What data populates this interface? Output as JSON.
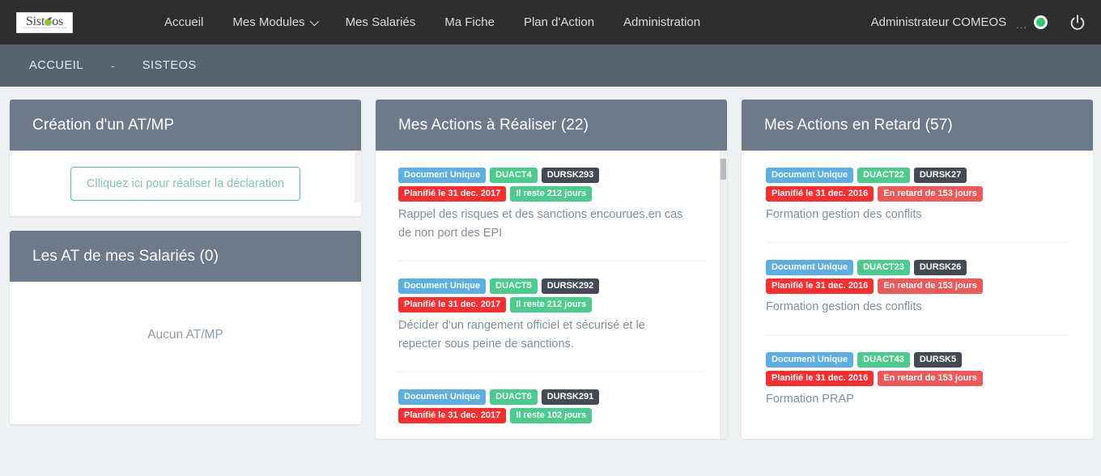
{
  "navbar": {
    "brand": {
      "text_before": "Sist",
      "apple_letter": "e",
      "text_after": "os",
      "tagline": "SOLUTION INFORMATIQUE SANTE & SECURITE AU TRAVAIL"
    },
    "links": [
      {
        "label": "Accueil",
        "has_caret": false
      },
      {
        "label": "Mes Modules",
        "has_caret": true
      },
      {
        "label": "Mes Salariés",
        "has_caret": false
      },
      {
        "label": "Ma Fiche",
        "has_caret": false
      },
      {
        "label": "Plan d'Action",
        "has_caret": false
      },
      {
        "label": "Administration",
        "has_caret": false
      }
    ],
    "user_name": "Administrateur COMEOS",
    "dots": "...",
    "status_color": "#2ecc71",
    "power_icon": "power-icon",
    "background_color": "#2e2e2e"
  },
  "breadcrumb": {
    "items": [
      "ACCUEIL",
      "SISTEOS"
    ],
    "separator": "-",
    "background_color": "#566470"
  },
  "colors": {
    "card_header": "#6c7a89",
    "page_background": "#eef2f3",
    "badge_blue": "#5bafe3",
    "badge_green": "#4bcc8e",
    "badge_dark": "#434a54",
    "badge_red": "#f92f2f",
    "badge_salmon": "#ef5858",
    "accent_green": "#4bcc94"
  },
  "cards": {
    "declaration": {
      "title": "Création d'un AT/MP",
      "button_label": "Clliquez ici pour réaliser la déclaration"
    },
    "employee_at": {
      "title": "Les AT de mes Salariés (0)",
      "empty_text": "Aucun AT/MP"
    },
    "actions_todo": {
      "title": "Mes Actions à Réaliser (22)",
      "items": [
        {
          "badges": [
            {
              "label": "Document Unique",
              "color": "#5bafe3"
            },
            {
              "label": "DUACT4",
              "color": "#4bcc8e"
            },
            {
              "label": "DURSK293",
              "color": "#434a54"
            }
          ],
          "badges2": [
            {
              "label": "Planifié le 31 dec. 2017",
              "color": "#f92f2f"
            },
            {
              "label": "Il reste 212 jours",
              "color": "#4bcc8e"
            }
          ],
          "description": "Rappel des risques et des sanctions encourues.en cas de non port des EPI"
        },
        {
          "badges": [
            {
              "label": "Document Unique",
              "color": "#5bafe3"
            },
            {
              "label": "DUACT5",
              "color": "#4bcc8e"
            },
            {
              "label": "DURSK292",
              "color": "#434a54"
            }
          ],
          "badges2": [
            {
              "label": "Planifié le 31 dec. 2017",
              "color": "#f92f2f"
            },
            {
              "label": "Il reste 212 jours",
              "color": "#4bcc8e"
            }
          ],
          "description": "Décider d'un rangement officiel et sécurisé et le repecter sous peine de sanctions."
        },
        {
          "badges": [
            {
              "label": "Document Unique",
              "color": "#5bafe3"
            },
            {
              "label": "DUACT6",
              "color": "#4bcc8e"
            },
            {
              "label": "DURSK291",
              "color": "#434a54"
            }
          ],
          "badges2": [
            {
              "label": "Planifié le 31 dec. 2017",
              "color": "#f92f2f"
            },
            {
              "label": "Il reste 102 jours",
              "color": "#4bcc8e"
            }
          ],
          "description": ""
        }
      ]
    },
    "actions_late": {
      "title": "Mes Actions en Retard (57)",
      "items": [
        {
          "badges": [
            {
              "label": "Document Unique",
              "color": "#5bafe3"
            },
            {
              "label": "DUACT22",
              "color": "#4bcc8e"
            },
            {
              "label": "DURSK27",
              "color": "#434a54"
            }
          ],
          "badges2": [
            {
              "label": "Planifié le 31 dec. 2016",
              "color": "#f92f2f"
            },
            {
              "label": "En retard de 153 jours",
              "color": "#ef5858"
            }
          ],
          "description": "Formation gestion des conflits"
        },
        {
          "badges": [
            {
              "label": "Document Unique",
              "color": "#5bafe3"
            },
            {
              "label": "DUACT23",
              "color": "#4bcc8e"
            },
            {
              "label": "DURSK26",
              "color": "#434a54"
            }
          ],
          "badges2": [
            {
              "label": "Planifié le 31 dec. 2016",
              "color": "#f92f2f"
            },
            {
              "label": "En retard de 153 jours",
              "color": "#ef5858"
            }
          ],
          "description": "Formation gestion des conflits"
        },
        {
          "badges": [
            {
              "label": "Document Unique",
              "color": "#5bafe3"
            },
            {
              "label": "DUACT43",
              "color": "#4bcc8e"
            },
            {
              "label": "DURSK5",
              "color": "#434a54"
            }
          ],
          "badges2": [
            {
              "label": "Planifié le 31 dec. 2016",
              "color": "#f92f2f"
            },
            {
              "label": "En retard de 153 jours",
              "color": "#ef5858"
            }
          ],
          "description": "Formation PRAP"
        }
      ]
    }
  }
}
